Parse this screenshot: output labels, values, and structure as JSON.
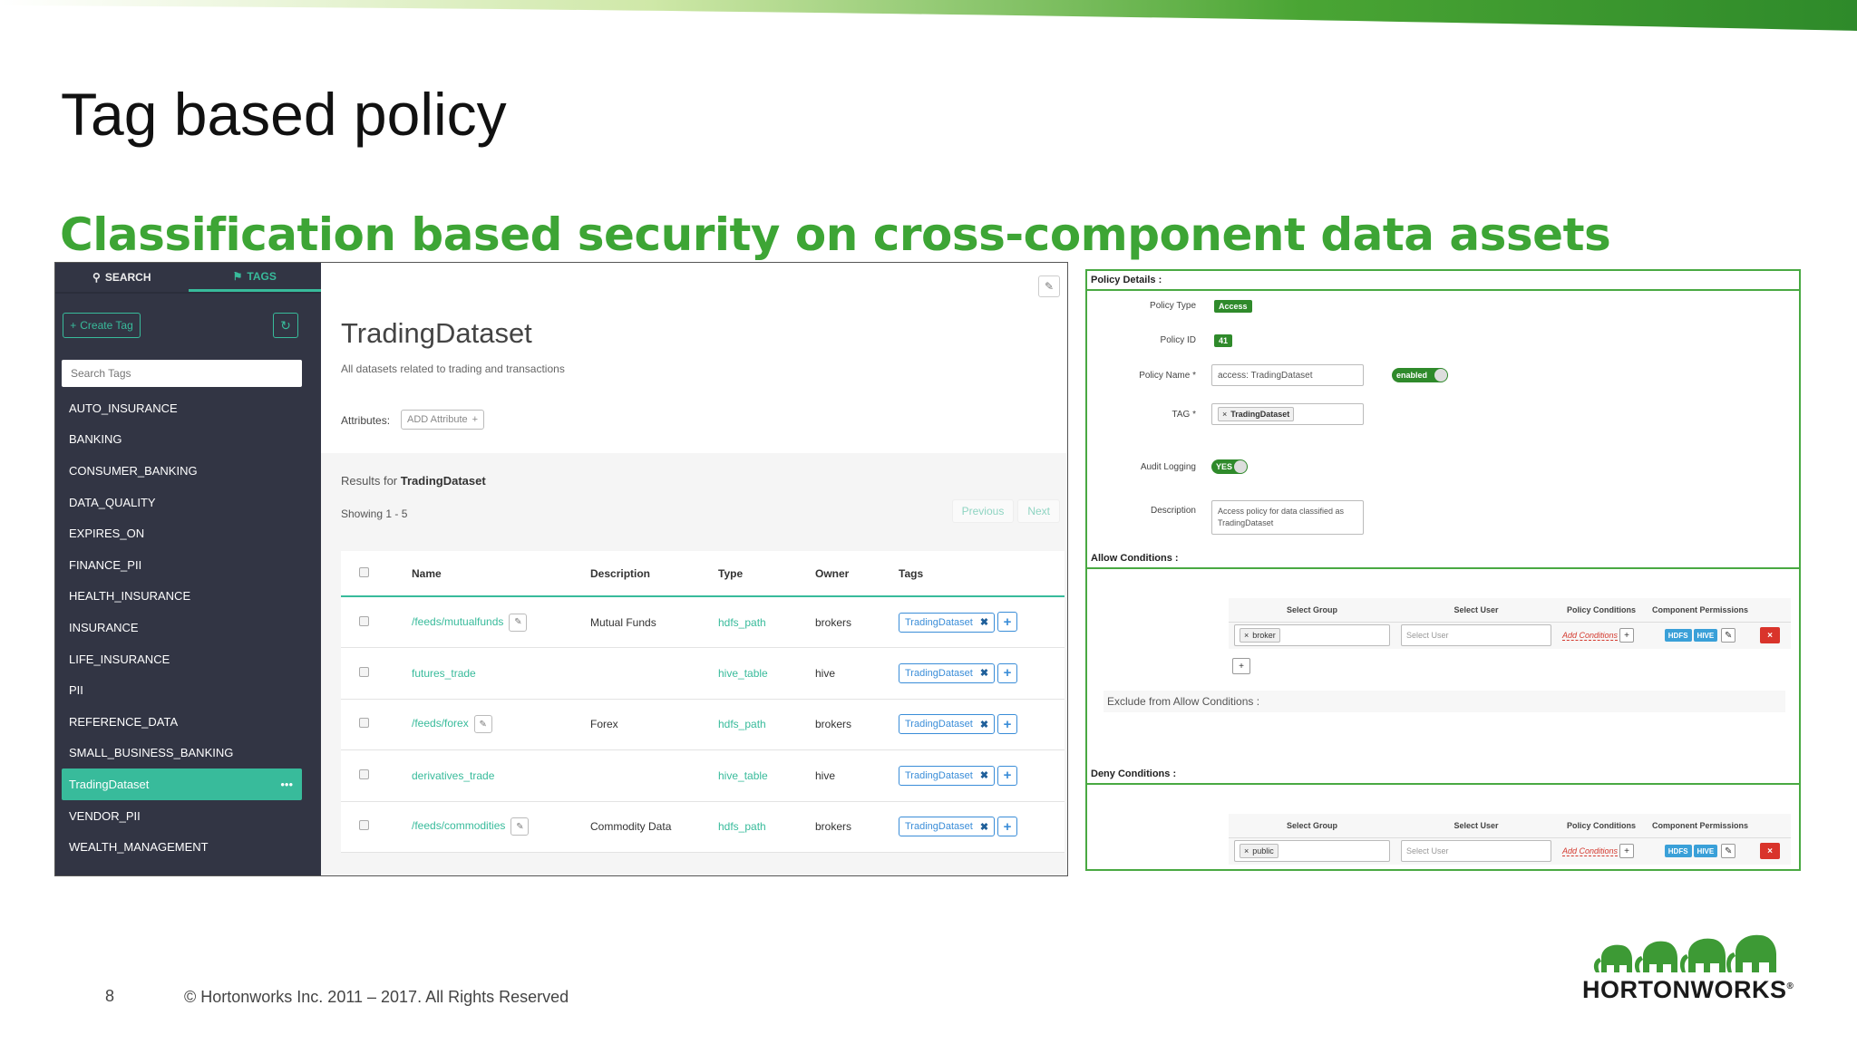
{
  "slide": {
    "title": "Tag based policy",
    "subtitle": "Classification based security on cross-component data assets",
    "page_number": "8",
    "copyright": "© Hortonworks Inc. 2011 – 2017. All Rights Reserved",
    "logo_text": "HORTONWORKS",
    "logo_mark": "®",
    "accent_color": "#3da535"
  },
  "atlas": {
    "tabs": [
      {
        "label": "SEARCH",
        "icon": "search-icon"
      },
      {
        "label": "TAGS",
        "icon": "tag-icon"
      }
    ],
    "create_tag_label": "Create Tag",
    "search_placeholder": "Search Tags",
    "tags": [
      "AUTO_INSURANCE",
      "BANKING",
      "CONSUMER_BANKING",
      "DATA_QUALITY",
      "EXPIRES_ON",
      "FINANCE_PII",
      "HEALTH_INSURANCE",
      "INSURANCE",
      "LIFE_INSURANCE",
      "PII",
      "REFERENCE_DATA",
      "SMALL_BUSINESS_BANKING",
      "TradingDataset",
      "VENDOR_PII",
      "WEALTH_MANAGEMENT"
    ],
    "active_tag_menu": "•••",
    "dataset_title": "TradingDataset",
    "dataset_description": "All datasets related to trading and transactions",
    "attributes_label": "Attributes:",
    "add_attribute_label": "ADD Attribute",
    "results_prefix": "Results for ",
    "results_name": "TradingDataset",
    "showing": "Showing 1 - 5",
    "previous": "Previous",
    "next": "Next",
    "columns": [
      "Name",
      "Description",
      "Type",
      "Owner",
      "Tags"
    ],
    "rows": [
      {
        "name": "/feeds/mutualfunds",
        "description": "Mutual Funds",
        "type": "hdfs_path",
        "owner": "brokers",
        "tag": "TradingDataset",
        "editable": true
      },
      {
        "name": "futures_trade",
        "description": "",
        "type": "hive_table",
        "owner": "hive",
        "tag": "TradingDataset",
        "editable": false
      },
      {
        "name": "/feeds/forex",
        "description": "Forex",
        "type": "hdfs_path",
        "owner": "brokers",
        "tag": "TradingDataset",
        "editable": true
      },
      {
        "name": "derivatives_trade",
        "description": "",
        "type": "hive_table",
        "owner": "hive",
        "tag": "TradingDataset",
        "editable": false
      },
      {
        "name": "/feeds/commodities",
        "description": "Commodity Data",
        "type": "hdfs_path",
        "owner": "brokers",
        "tag": "TradingDataset",
        "editable": true
      }
    ]
  },
  "ranger": {
    "policy_details_label": "Policy Details :",
    "policy_type_label": "Policy Type",
    "policy_type": "Access",
    "policy_id_label": "Policy ID",
    "policy_id": "41",
    "policy_name_label": "Policy Name *",
    "policy_name": "access: TradingDataset",
    "enabled_label": "enabled",
    "tag_label": "TAG *",
    "tag_value": "TradingDataset",
    "audit_label": "Audit Logging",
    "audit_value": "YES",
    "description_label": "Description",
    "description": "Access policy for data classified as TradingDataset",
    "allow_label": "Allow Conditions :",
    "deny_label": "Deny Conditions :",
    "exclude_label": "Exclude from Allow Conditions :",
    "cond_columns": [
      "Select Group",
      "Select User",
      "Policy Conditions",
      "Component Permissions"
    ],
    "allow_group": "broker",
    "deny_group": "public",
    "select_user_placeholder": "Select User",
    "add_conditions": "Add Conditions",
    "perm_hdfs": "HDFS",
    "perm_hive": "HIVE"
  }
}
